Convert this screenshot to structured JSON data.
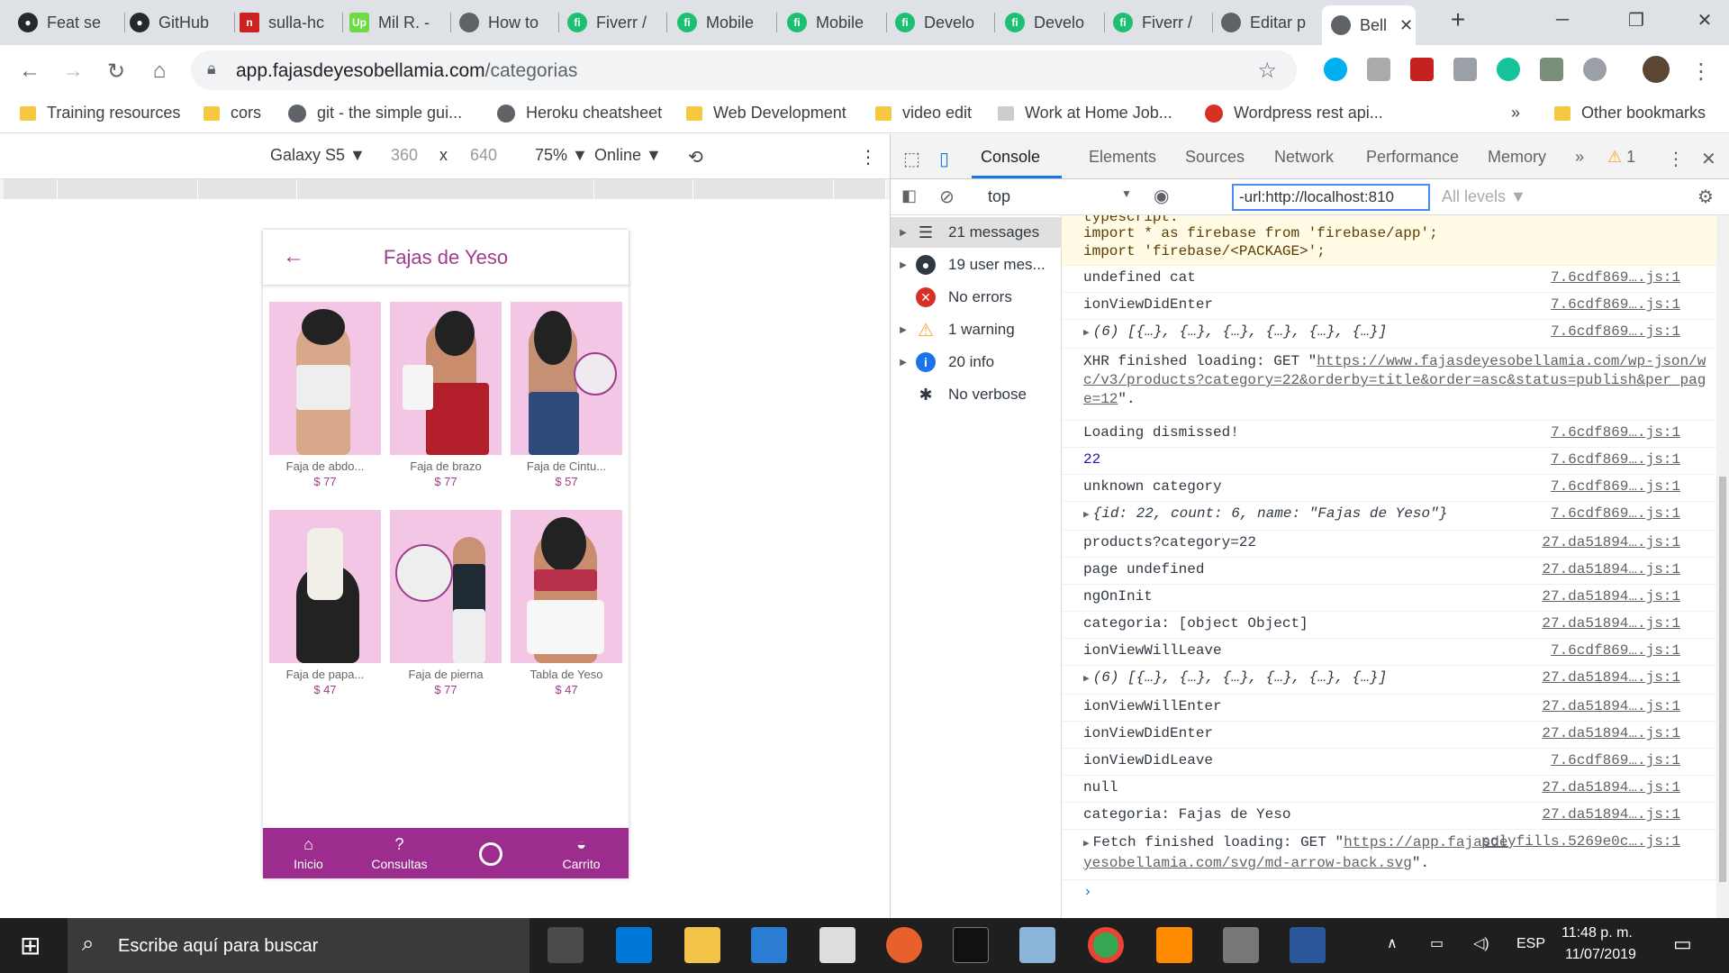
{
  "browser": {
    "tabs": [
      {
        "title": "Feat se",
        "icon": "github-icon"
      },
      {
        "title": "GitHub",
        "icon": "github-icon"
      },
      {
        "title": "sulla-hc",
        "icon": "n-icon"
      },
      {
        "title": "Mil R. -",
        "icon": "upwork-icon"
      },
      {
        "title": "How to",
        "icon": "globe-icon"
      },
      {
        "title": "Fiverr /",
        "icon": "fiverr-icon"
      },
      {
        "title": "Mobile",
        "icon": "fiverr-icon"
      },
      {
        "title": "Mobile",
        "icon": "fiverr-icon"
      },
      {
        "title": "Develo",
        "icon": "fiverr-icon"
      },
      {
        "title": "Develo",
        "icon": "fiverr-icon"
      },
      {
        "title": "Fiverr /",
        "icon": "fiverr-icon"
      },
      {
        "title": "Editar p",
        "icon": "globe-icon"
      },
      {
        "title": "Bell",
        "icon": "globe-icon"
      }
    ],
    "url_host": "app.fajasdeyesobellamia.com",
    "url_path": "/categorias",
    "bookmarks": [
      {
        "label": "Training resources",
        "icon": "folder-icon"
      },
      {
        "label": "cors",
        "icon": "folder-icon"
      },
      {
        "label": "git - the simple gui...",
        "icon": "globe-icon"
      },
      {
        "label": "Heroku cheatsheet",
        "icon": "globe-icon"
      },
      {
        "label": "Web Development",
        "icon": "folder-icon"
      },
      {
        "label": "video edit",
        "icon": "folder-icon"
      },
      {
        "label": "Work at Home Job...",
        "icon": "image-icon"
      },
      {
        "label": "Wordpress rest api...",
        "icon": "globe-icon"
      }
    ],
    "bookmarks_more": "»",
    "other_bookmarks": "Other bookmarks"
  },
  "device_toolbar": {
    "device": "Galaxy S5",
    "width": "360",
    "times": "x",
    "height": "640",
    "zoom": "75%",
    "throttle": "Online"
  },
  "app": {
    "title": "Fajas de Yeso",
    "products": [
      {
        "name": "Faja de abdo...",
        "price": "$ 77"
      },
      {
        "name": "Faja de brazo",
        "price": "$ 77"
      },
      {
        "name": "Faja de Cintu...",
        "price": "$ 57"
      },
      {
        "name": "Faja de papa...",
        "price": "$ 47"
      },
      {
        "name": "Faja de pierna",
        "price": "$ 77"
      },
      {
        "name": "Tabla de Yeso",
        "price": "$ 47"
      }
    ],
    "tabs": [
      {
        "label": "Inicio",
        "icon": "home-icon"
      },
      {
        "label": "Consultas",
        "icon": "question-icon"
      },
      {
        "label": "",
        "icon": "whatsapp-icon"
      },
      {
        "label": "Carrito",
        "icon": "basket-icon"
      }
    ]
  },
  "devtools": {
    "tabs": [
      "Console",
      "Elements",
      "Sources",
      "Network",
      "Performance",
      "Memory"
    ],
    "more": "»",
    "warning_count": "1",
    "context": "top",
    "filter": "-url:http://localhost:810",
    "levels": "All levels",
    "sidebar": [
      {
        "label": "21 messages",
        "icon": "list-icon"
      },
      {
        "label": "19 user mes...",
        "icon": "user-icon"
      },
      {
        "label": "No errors",
        "icon": "error-icon"
      },
      {
        "label": "1 warning",
        "icon": "warning-icon"
      },
      {
        "label": "20 info",
        "icon": "info-icon"
      },
      {
        "label": "No verbose",
        "icon": "bug-icon"
      }
    ],
    "warning_lines": [
      "typescript:",
      "import * as firebase from 'firebase/app';",
      "import 'firebase/<PACKAGE>';"
    ],
    "console": [
      {
        "msg": "undefined cat",
        "src": "7.6cdf869….js:1"
      },
      {
        "msg": "ionViewDidEnter",
        "src": "7.6cdf869….js:1"
      },
      {
        "msg": "(6) [{…}, {…}, {…}, {…}, {…}, {…}]",
        "src": "7.6cdf869….js:1"
      },
      {
        "msg": "XHR finished loading: GET \"",
        "link": "https://www.fajasdeyesobellamia.com/wp-json/wc/v3/products?category=22&orderby=title&order=asc&status=publish&per_page=12",
        "src": ""
      },
      {
        "msg": "Loading dismissed!",
        "src": "7.6cdf869….js:1"
      },
      {
        "msg": "22",
        "src": "7.6cdf869….js:1"
      },
      {
        "msg": "unknown category",
        "src": "7.6cdf869….js:1"
      },
      {
        "msg": "{id: 22, count: 6, name: \"Fajas de Yeso\"}",
        "src": "7.6cdf869….js:1"
      },
      {
        "msg": "products?category=22",
        "src": "27.da51894….js:1"
      },
      {
        "msg": "page undefined",
        "src": "27.da51894….js:1"
      },
      {
        "msg": "ngOnInit",
        "src": "27.da51894….js:1"
      },
      {
        "msg": "categoria: [object Object]",
        "src": "27.da51894….js:1"
      },
      {
        "msg": "ionViewWillLeave",
        "src": "7.6cdf869….js:1"
      },
      {
        "msg": "(6) [{…}, {…}, {…}, {…}, {…}, {…}]",
        "src": "27.da51894….js:1"
      },
      {
        "msg": "ionViewWillEnter",
        "src": "27.da51894….js:1"
      },
      {
        "msg": "ionViewDidEnter",
        "src": "27.da51894….js:1"
      },
      {
        "msg": "ionViewDidLeave",
        "src": "7.6cdf869….js:1"
      },
      {
        "msg": "null",
        "src": "27.da51894….js:1"
      },
      {
        "msg": "categoria: Fajas de Yeso",
        "src": "27.da51894….js:1"
      },
      {
        "msg": "Fetch finished loading: GET \"",
        "link": "https://app.fajasdeyesobellamia.com/svg/md-arrow-back.svg",
        "src": "polyfills.5269e0c….js:1"
      }
    ],
    "prompt": "›"
  },
  "taskbar": {
    "search_placeholder": "Escribe aquí para buscar",
    "lang": "ESP",
    "time": "11:48 p. m.",
    "date": "11/07/2019"
  }
}
